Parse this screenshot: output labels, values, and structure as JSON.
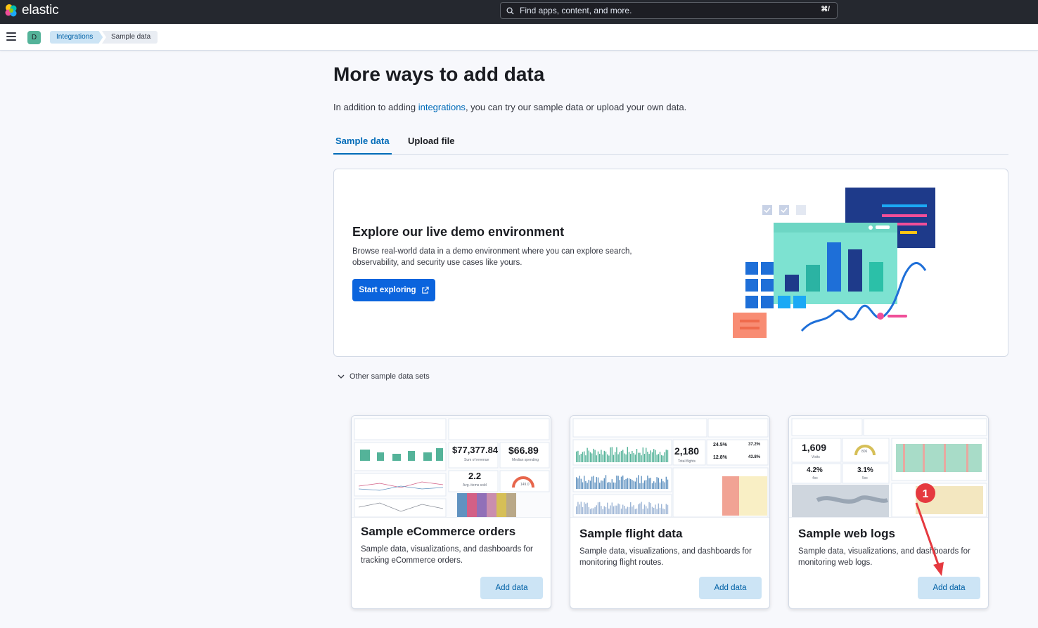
{
  "header": {
    "brand": "elastic",
    "search_placeholder": "Find apps, content, and more.",
    "search_shortcut": "⌘/"
  },
  "subnav": {
    "space_initial": "D",
    "breadcrumbs": [
      "Integrations",
      "Sample data"
    ]
  },
  "main": {
    "title": "More ways to add data",
    "intro_prefix": "In addition to adding ",
    "intro_link": "integrations",
    "intro_suffix": ", you can try our sample data or upload your own data.",
    "tabs": [
      {
        "label": "Sample data",
        "active": true
      },
      {
        "label": "Upload file",
        "active": false
      }
    ]
  },
  "demo": {
    "title": "Explore our live demo environment",
    "description": "Browse real-world data in a demo environment where you can explore search, observability, and security use cases like yours.",
    "button_label": "Start exploring"
  },
  "accordion_label": "Other sample data sets",
  "cards": [
    {
      "title": "Sample eCommerce orders",
      "description": "Sample data, visualizations, and dashboards for tracking eCommerce orders.",
      "button_label": "Add data",
      "thumb": {
        "metric1": "$77,377.84",
        "metric1_label": "Sum of revenue",
        "metric2": "$66.89",
        "metric2_label": "Median spending",
        "metric3": "2.2",
        "metric3_label": "Avg. items sold",
        "gauge_value": "149.0"
      }
    },
    {
      "title": "Sample flight data",
      "description": "Sample data, visualizations, and dashboards for monitoring flight routes.",
      "button_label": "Add data",
      "thumb": {
        "metric1": "2,180",
        "metric1_label": "Total flights",
        "pct1": "24.5%",
        "pct2": "37.2%",
        "pct3": "12.8%",
        "pct4": "43.8%"
      }
    },
    {
      "title": "Sample web logs",
      "description": "Sample data, visualizations, and dashboards for monitoring web logs.",
      "button_label": "Add data",
      "thumb": {
        "metric1": "1,609",
        "metric1_label": "Visits",
        "metric2": "4.2%",
        "metric2_label": "4xx",
        "metric3": "3.1%",
        "metric3_label": "5xx",
        "gauge_value": "806"
      }
    }
  ],
  "annotation": {
    "marker": "1"
  },
  "colors": {
    "topbar": "#25282f",
    "primary": "#0b64dd",
    "link": "#006bb8",
    "secondary_btn_bg": "#cce4f5",
    "annotation": "#e5393f"
  }
}
